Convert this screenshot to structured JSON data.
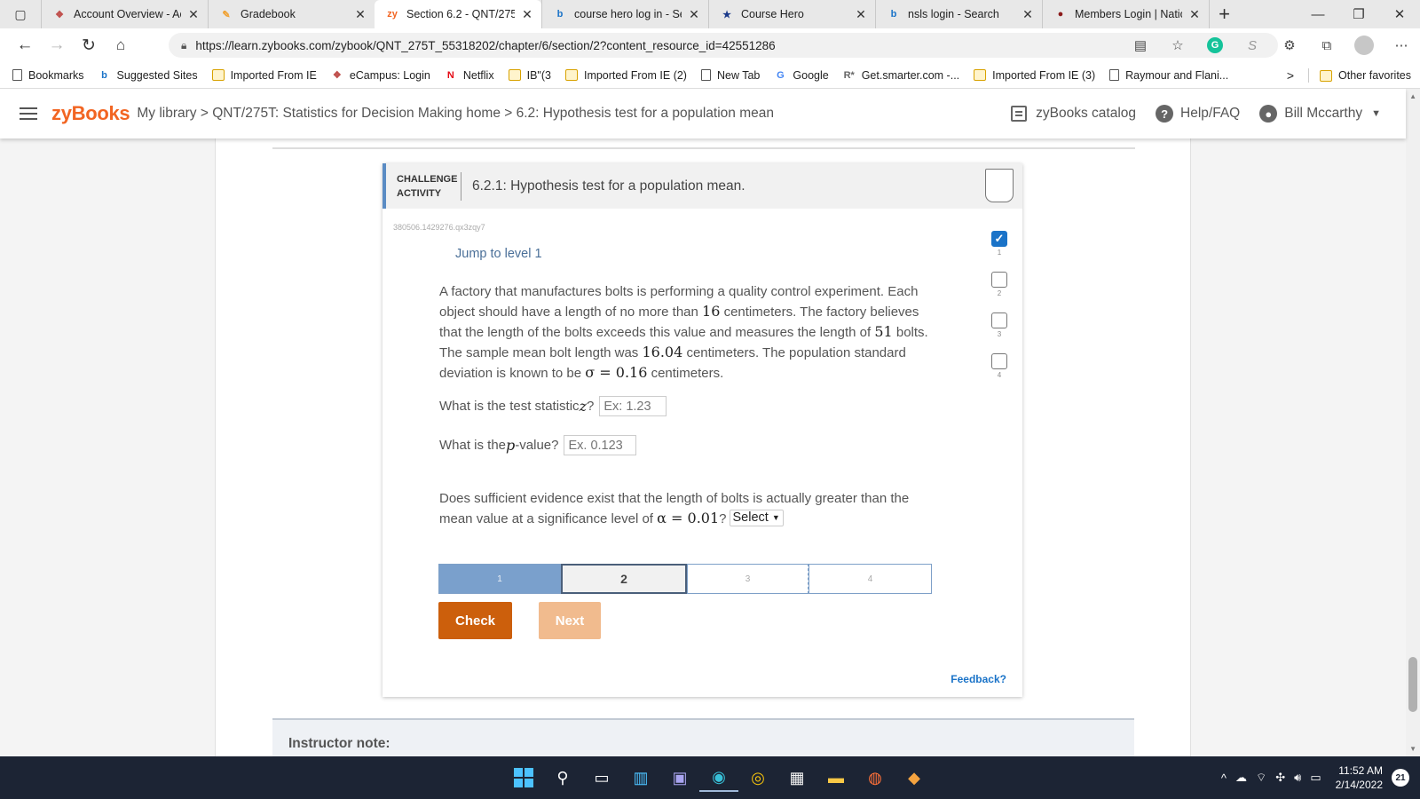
{
  "browser": {
    "tabs": [
      {
        "title": "Account Overview - Acc",
        "fav": "❖",
        "fav_color": "#c0504d",
        "active": false
      },
      {
        "title": "Gradebook",
        "fav": "✎",
        "fav_color": "#f0a030",
        "active": false
      },
      {
        "title": "Section 6.2 - QNT/275T",
        "fav": "zy",
        "fav_color": "#f26522",
        "active": true
      },
      {
        "title": "course hero log in - Sea",
        "fav": "b",
        "fav_color": "#1a73c8",
        "active": false
      },
      {
        "title": "Course Hero",
        "fav": "★",
        "fav_color": "#1b3a8a",
        "active": false
      },
      {
        "title": "nsls login - Search",
        "fav": "b",
        "fav_color": "#1a73c8",
        "active": false
      },
      {
        "title": "Members Login | Natio",
        "fav": "●",
        "fav_color": "#8b1a1a",
        "active": false
      }
    ],
    "url": "https://learn.zybooks.com/zybook/QNT_275T_55318202/chapter/6/section/2?content_resource_id=42551286",
    "favorites": [
      {
        "label": "Bookmarks",
        "type": "page"
      },
      {
        "label": "Suggested Sites",
        "type": "bing"
      },
      {
        "label": "Imported From IE",
        "type": "folder"
      },
      {
        "label": "eCampus: Login",
        "type": "ecampus"
      },
      {
        "label": "Netflix",
        "type": "netflix"
      },
      {
        "label": "IB\"(3",
        "type": "folder"
      },
      {
        "label": "Imported From IE (2)",
        "type": "folder"
      },
      {
        "label": "New Tab",
        "type": "page"
      },
      {
        "label": "Google",
        "type": "google"
      },
      {
        "label": "Get.smarter.com -...",
        "type": "rstar"
      },
      {
        "label": "Imported From IE (3)",
        "type": "folder"
      },
      {
        "label": "Raymour and Flani...",
        "type": "page"
      }
    ],
    "other_favorites": "Other favorites"
  },
  "header": {
    "logo": "zyBooks",
    "breadcrumb": "My library > QNT/275T: Statistics for Decision Making home > 6.2: Hypothesis test for a population mean",
    "catalog": "zyBooks catalog",
    "help": "Help/FAQ",
    "user": "Bill Mccarthy"
  },
  "activity": {
    "kind_line1": "CHALLENGE",
    "kind_line2": "ACTIVITY",
    "title": "6.2.1: Hypothesis test for a population mean.",
    "id": "380506.1429276.qx3zqy7",
    "jump": "Jump to level 1",
    "problem": {
      "t1": "A factory that manufactures bolts is performing a quality control experiment. Each object should have a length of no more than ",
      "v1": "16",
      "t2": " centimeters. The factory believes that the length of the bolts exceeds this value and measures the length of ",
      "v2": "51",
      "t3": " bolts. The sample mean bolt length was ",
      "v3": "16.04",
      "t4": " centimeters. The population standard deviation is known to be ",
      "v4": "σ = 0.16",
      "t5": " centimeters."
    },
    "q1": {
      "before": "What is the test statistic ",
      "var": "z",
      "after": "?",
      "placeholder": "Ex: 1.23"
    },
    "q2": {
      "before": "What is the ",
      "var": "p",
      "after": "-value?",
      "placeholder": "Ex. 0.123"
    },
    "q3": {
      "before": "Does sufficient evidence exist that the length of bolts is actually greater than the mean value at a significance level of ",
      "alpha": "α = 0.01",
      "after": "?",
      "select": "Select"
    },
    "levels": [
      {
        "num": "1",
        "done": true
      },
      {
        "num": "2",
        "done": false
      },
      {
        "num": "3",
        "done": false
      },
      {
        "num": "4",
        "done": false
      }
    ],
    "progress": [
      "1",
      "2",
      "3",
      "4"
    ],
    "check": "Check",
    "next": "Next",
    "feedback": "Feedback?"
  },
  "instructor_note": "Instructor note:",
  "taskbar": {
    "time": "11:52 AM",
    "date": "2/14/2022",
    "notifications": "21"
  },
  "colors": {
    "zybooks_orange": "#f26522",
    "check_button": "#cc5f0c",
    "next_button_disabled": "#f1bb8e",
    "progress_done": "#7aa0cc",
    "link_blue": "#1a73c8"
  }
}
